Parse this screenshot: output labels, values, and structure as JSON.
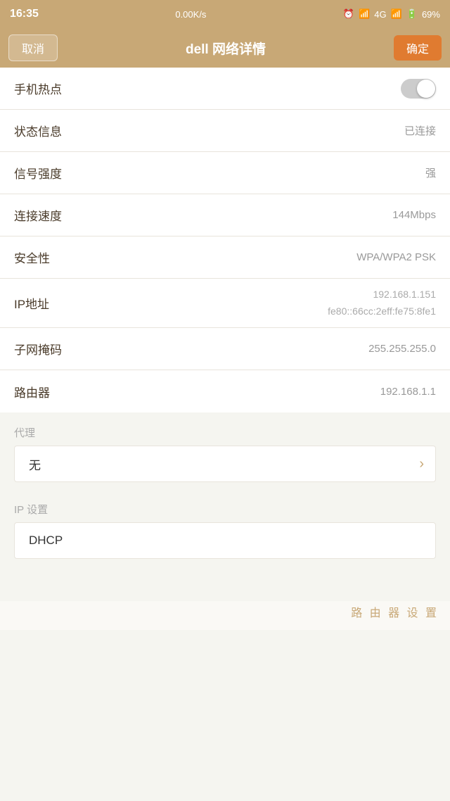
{
  "statusBar": {
    "time": "16:35",
    "speed": "0.00K/s",
    "network": "4G",
    "battery": "69%"
  },
  "navBar": {
    "cancelLabel": "取消",
    "title": "dell  网络详情",
    "confirmLabel": "确定"
  },
  "rows": {
    "hotspot": {
      "label": "手机热点",
      "toggleOff": true
    },
    "status": {
      "label": "状态信息",
      "value": "已连接"
    },
    "signal": {
      "label": "信号强度",
      "value": "强"
    },
    "speed": {
      "label": "连接速度",
      "value": "144Mbps"
    },
    "security": {
      "label": "安全性",
      "value": "WPA/WPA2 PSK"
    },
    "ip": {
      "label": "IP地址",
      "value1": "192.168.1.151",
      "value2": "fe80::66cc:2eff:fe75:8fe1"
    },
    "subnet": {
      "label": "子网掩码",
      "value": "255.255.255.0"
    },
    "router": {
      "label": "路由器",
      "value": "192.168.1.1"
    }
  },
  "proxy": {
    "sectionLabel": "代理",
    "value": "无",
    "chevron": "›"
  },
  "ipSettings": {
    "sectionLabel": "IP 设置",
    "value": "DHCP"
  },
  "routerSettingsBtn": "路 由 器 设 置"
}
